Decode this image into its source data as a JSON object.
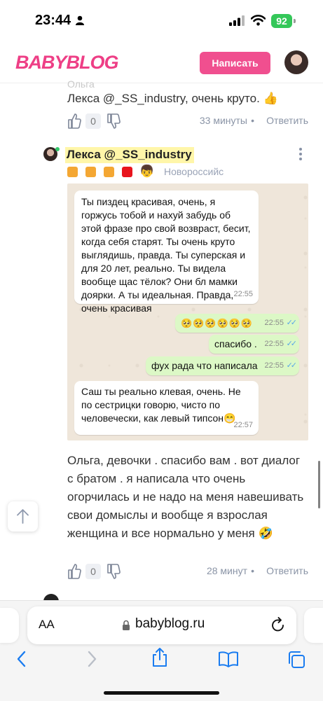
{
  "status_bar": {
    "time": "23:44",
    "battery": "92"
  },
  "header": {
    "logo": "BABYBLOG",
    "write_button": "Написать"
  },
  "comment1": {
    "text": "Лекса @_SS_industry, очень круто. 👍",
    "likes": "0",
    "time_ago": "33 минуты",
    "separator": "•",
    "reply_label": "Ответить"
  },
  "comment2": {
    "author": "Лекса @_SS_industry",
    "location": "Новороссийск",
    "kid_emoji": "👦",
    "text": "Ольга, девочки . спасибо вам . вот диалог с братом . я написала что очень огорчилась и не надо на меня навешивать свои домыслы и вообще я взрослая женщина и все нормально у меня 🤣",
    "likes": "0",
    "time_ago": "28 минут",
    "separator": "•",
    "reply_label": "Ответить"
  },
  "chat_screenshot": {
    "messages": [
      {
        "side": "in",
        "text": "Ты пиздец красивая, очень, я горжусь тобой и нахуй забудь об этой фразе про свой возвраст, бесит, когда себя старят. Ты очень круто выглядишь, правда. Ты суперская и для 20 лет, реально. Ты видела вообще щас тёлок? Они бл мамки доярки. А ты идеальная. Правда, очень красивая",
        "time": "22:55"
      },
      {
        "side": "out",
        "text": "🥺🥺🥺🥺🥺🥺",
        "time": "22:55",
        "ticks": "✓✓"
      },
      {
        "side": "out",
        "text": "спасибо .",
        "time": "22:55",
        "ticks": "✓✓"
      },
      {
        "side": "out",
        "text": "фух рада что написала",
        "time": "22:55",
        "ticks": "✓✓"
      },
      {
        "side": "in",
        "text": "Саш ты реально клевая, очень. Не по сестрицки говорю, чисто по человечески, как левый типсон😁",
        "time": "22:57"
      }
    ]
  },
  "safari": {
    "text_size_label": "AA",
    "url": "babyblog.ru"
  },
  "colors": {
    "brand_pink": "#ee3f86",
    "button_pink": "#f04f8f",
    "highlight": "#fff6a9",
    "safari_blue": "#1a7cf0",
    "chat_out": "#dcf8c6"
  }
}
